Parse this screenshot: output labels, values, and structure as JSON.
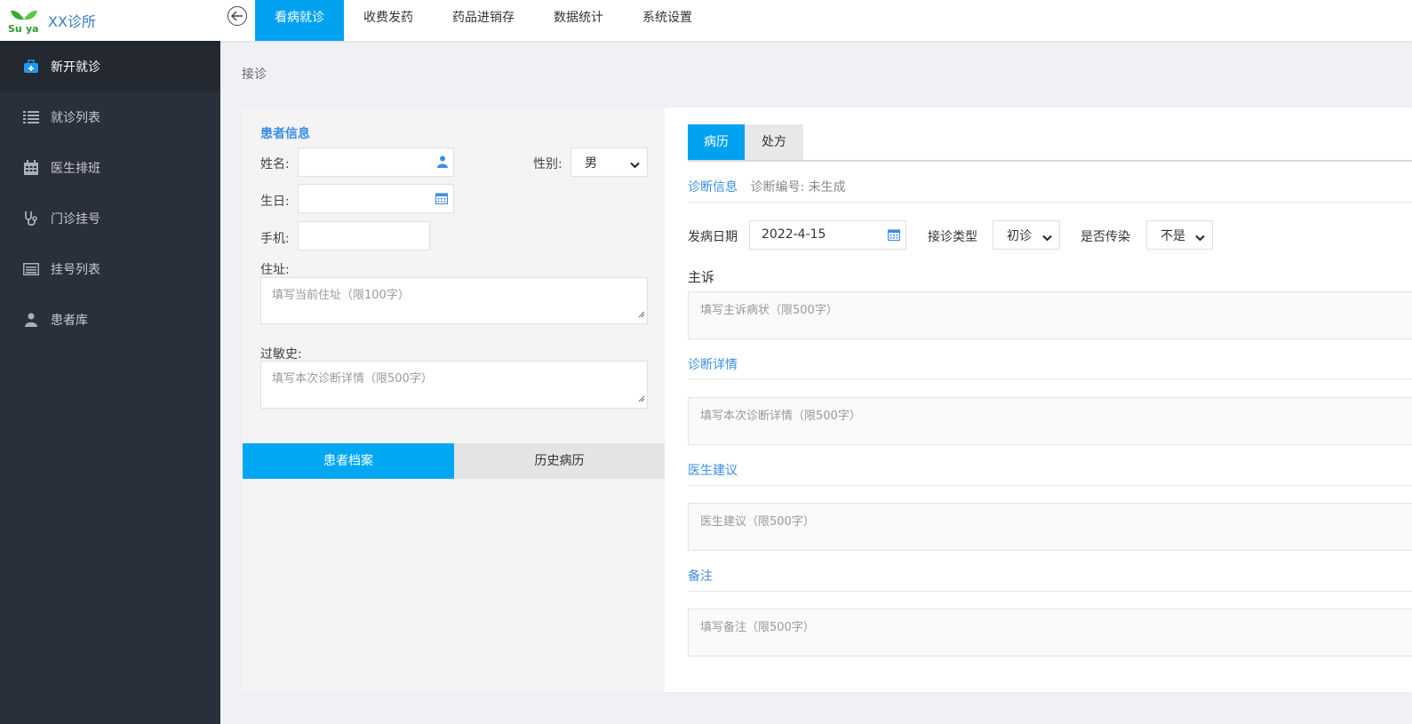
{
  "app": {
    "logo_text": "Su ya",
    "title": "XX诊所"
  },
  "topnav": [
    {
      "label": "看病就诊",
      "active": true
    },
    {
      "label": "收费发药",
      "active": false
    },
    {
      "label": "药品进销存",
      "active": false
    },
    {
      "label": "数据统计",
      "active": false
    },
    {
      "label": "系统设置",
      "active": false
    }
  ],
  "sidebar": [
    {
      "label": "新开就诊",
      "icon": "medical-kit-icon",
      "active": true
    },
    {
      "label": "就诊列表",
      "icon": "list-icon",
      "active": false
    },
    {
      "label": "医生排班",
      "icon": "calendar-icon",
      "active": false
    },
    {
      "label": "门诊挂号",
      "icon": "stethoscope-icon",
      "active": false
    },
    {
      "label": "挂号列表",
      "icon": "register-list-icon",
      "active": false
    },
    {
      "label": "患者库",
      "icon": "user-icon",
      "active": false
    }
  ],
  "breadcrumb": "接诊",
  "patient": {
    "section_title": "患者信息",
    "name_label": "姓名:",
    "name_value": "",
    "gender_label": "性别:",
    "gender_value": "男",
    "birthday_label": "生日:",
    "birthday_value": "",
    "phone_label": "手机:",
    "phone_value": "",
    "address_label": "住址:",
    "address_placeholder": "填写当前住址（限100字）",
    "allergy_label": "过敏史:",
    "allergy_placeholder": "填写本次诊断详情（限500字）",
    "tab_archive": "患者档案",
    "tab_history": "历史病历"
  },
  "record": {
    "tabs": [
      {
        "label": "病历",
        "active": true
      },
      {
        "label": "处方",
        "active": false
      }
    ],
    "diag_info_label": "诊断信息",
    "diag_no_label": "诊断编号: 未生成",
    "onset_label": "发病日期",
    "onset_value": "2022-4-15",
    "visit_type_label": "接诊类型",
    "visit_type_value": "初诊",
    "infectious_label": "是否传染",
    "infectious_value": "不是",
    "complaint_label": "主诉",
    "complaint_placeholder": "填写主诉病状（限500字）",
    "diag_detail_label": "诊断详情",
    "diag_detail_placeholder": "填写本次诊断详情（限500字）",
    "advice_label": "医生建议",
    "advice_placeholder": "医生建议（限500字）",
    "remark_label": "备注",
    "remark_placeholder": "填写备注（限500字）"
  },
  "colors": {
    "accent": "#00a2f0",
    "sidebar_bg": "#2a303b",
    "link_blue": "#3a8ee6"
  }
}
